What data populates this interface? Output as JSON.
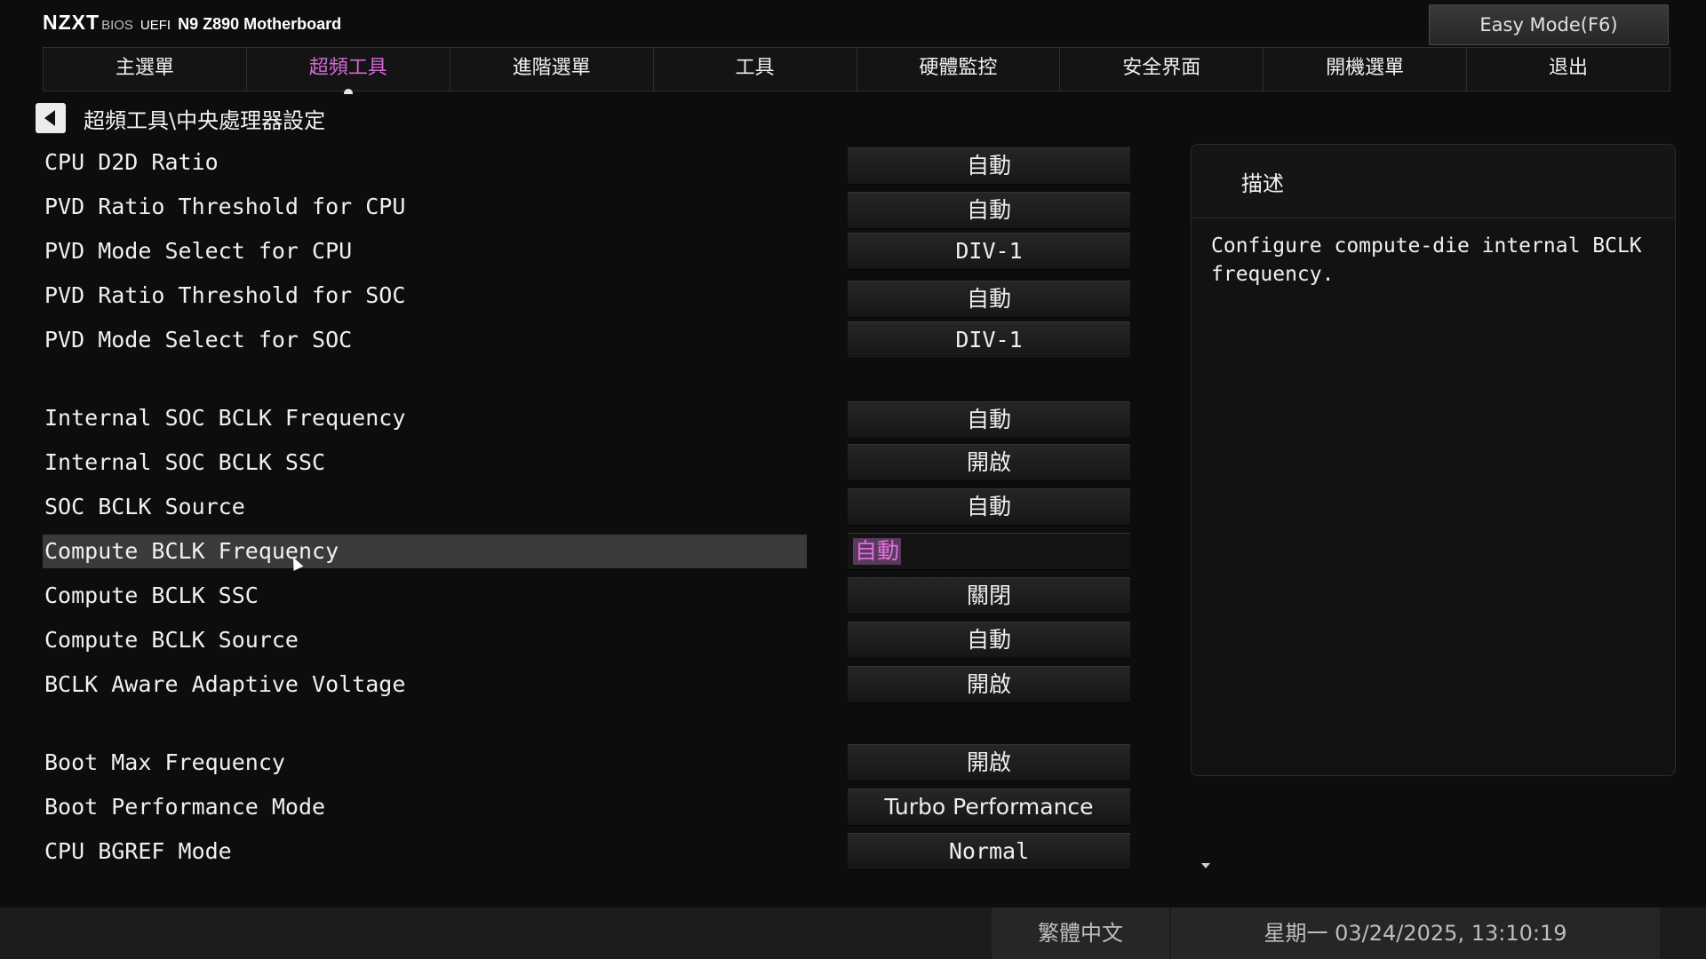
{
  "brand": {
    "logo": "NZXT",
    "bios": "BIOS",
    "uefi": "UEFI",
    "model": "N9 Z890 Motherboard"
  },
  "easy_mode_label": "Easy Mode(F6)",
  "tabs": [
    {
      "label": "主選單"
    },
    {
      "label": "超頻工具",
      "active": true
    },
    {
      "label": "進階選單"
    },
    {
      "label": "工具"
    },
    {
      "label": "硬體監控"
    },
    {
      "label": "安全界面"
    },
    {
      "label": "開機選單"
    },
    {
      "label": "退出"
    }
  ],
  "breadcrumb": "超頻工具\\中央處理器設定",
  "settings": [
    {
      "label": "CPU D2D Ratio",
      "value": "自動"
    },
    {
      "label": "PVD Ratio Threshold for CPU",
      "value": "自動"
    },
    {
      "label": "PVD Mode Select for CPU",
      "value": "DIV-1"
    },
    {
      "label": "PVD Ratio Threshold for SOC",
      "value": "自動"
    },
    {
      "label": "PVD Mode Select for SOC",
      "value": "DIV-1"
    },
    {
      "label": "Internal SOC BCLK Frequency",
      "value": "自動"
    },
    {
      "label": "Internal SOC BCLK SSC",
      "value": "開啟"
    },
    {
      "label": "SOC BCLK Source",
      "value": "自動"
    },
    {
      "label": "Compute BCLK Frequency",
      "value": "自動",
      "selected": true
    },
    {
      "label": "Compute BCLK SSC",
      "value": "關閉"
    },
    {
      "label": "Compute BCLK Source",
      "value": "自動"
    },
    {
      "label": "BCLK Aware Adaptive Voltage",
      "value": "開啟"
    },
    {
      "label": "Boot Max Frequency",
      "value": "開啟"
    },
    {
      "label": "Boot Performance Mode",
      "value": "Turbo Performance"
    },
    {
      "label": "CPU BGREF Mode",
      "value": "Normal"
    }
  ],
  "description": {
    "title": "描述",
    "text": "Configure compute-die internal BCLK frequency."
  },
  "footer": {
    "language": "繁體中文",
    "datetime": "星期一 03/24/2025, 13:10:19"
  },
  "colors": {
    "accent": "#d36ad6",
    "background": "#0d0d0d",
    "selected_row": "#3a3a3a"
  }
}
